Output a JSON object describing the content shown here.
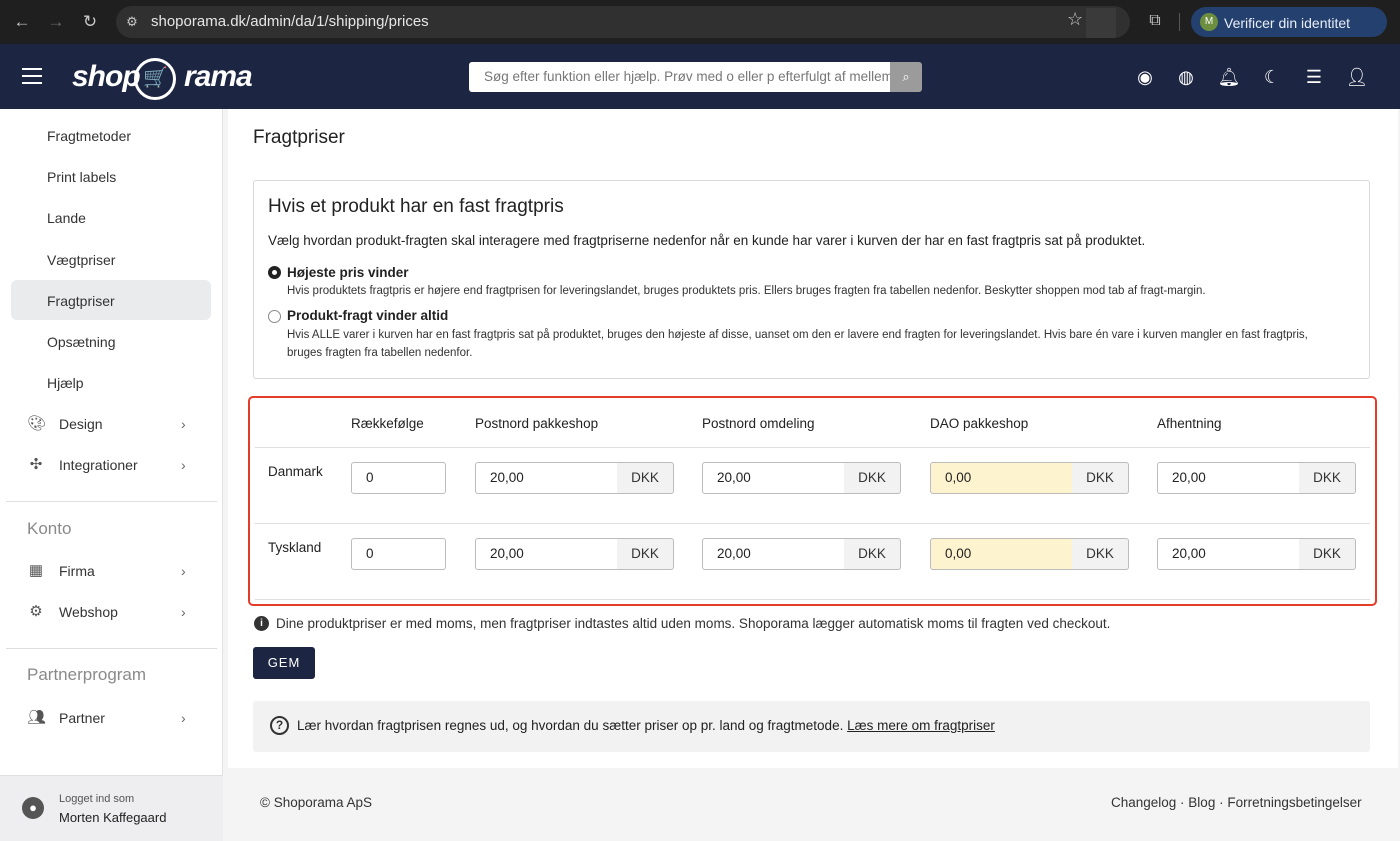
{
  "browser": {
    "url": "shoporama.dk/admin/da/1/shipping/prices",
    "verify_label": "Verificer din identitet",
    "avatar_letter": "M"
  },
  "header": {
    "logo_left": "shop",
    "logo_right": "rama",
    "search_placeholder": "Søg efter funktion eller hjælp. Prøv med o eller p efterfulgt af mellemrum"
  },
  "sidebar": {
    "items": [
      {
        "label": "Fragtmetoder"
      },
      {
        "label": "Print labels"
      },
      {
        "label": "Lande"
      },
      {
        "label": "Vægtpriser"
      },
      {
        "label": "Fragtpriser"
      },
      {
        "label": "Opsætning"
      },
      {
        "label": "Hjælp"
      }
    ],
    "groups": [
      {
        "label": "Design",
        "icon": "palette-icon"
      },
      {
        "label": "Integrationer",
        "icon": "puzzle-icon"
      }
    ],
    "konto_title": "Konto",
    "konto_items": [
      {
        "label": "Firma",
        "icon": "building-icon"
      },
      {
        "label": "Webshop",
        "icon": "gear-icon"
      }
    ],
    "partner_title": "Partnerprogram",
    "partner_items": [
      {
        "label": "Partner",
        "icon": "people-icon"
      }
    ],
    "logged_in_label": "Logget ind som",
    "logged_in_name": "Morten Kaffegaard"
  },
  "main": {
    "page_title": "Fragtpriser",
    "fixed_box": {
      "title": "Hvis et produkt har en fast fragtpris",
      "description": "Vælg hvordan produkt-fragten skal interagere med fragtpriserne nedenfor når en kunde har varer i kurven der har en fast fragtpris sat på produktet.",
      "options": [
        {
          "label": "Højeste pris vinder",
          "help": "Hvis produktets fragtpris er højere end fragtprisen for leveringslandet, bruges produktets pris. Ellers bruges fragten fra tabellen nedenfor. Beskytter shoppen mod tab af fragt-margin.",
          "checked": true
        },
        {
          "label": "Produkt-fragt vinder altid",
          "help": "Hvis ALLE varer i kurven har en fast fragtpris sat på produktet, bruges den højeste af disse, uanset om den er lavere end fragten for leveringslandet. Hvis bare én vare i kurven mangler en fast fragtpris, bruges fragten fra tabellen nedenfor.",
          "checked": false
        }
      ]
    },
    "table": {
      "columns": [
        "Rækkefølge",
        "Postnord pakkeshop",
        "Postnord omdeling",
        "DAO pakkeshop",
        "Afhentning"
      ],
      "currency": "DKK",
      "rows": [
        {
          "country": "Danmark",
          "order": "0",
          "prices": [
            "20,00",
            "20,00",
            "0,00",
            "20,00"
          ]
        },
        {
          "country": "Tyskland",
          "order": "0",
          "prices": [
            "20,00",
            "20,00",
            "0,00",
            "20,00"
          ]
        }
      ]
    },
    "info_text": "Dine produktpriser er med moms, men fragtpriser indtastes altid uden moms. Shoporama lægger automatisk moms til fragten ved checkout.",
    "save_label": "GEM",
    "help_text": "Lær hvordan fragtprisen regnes ud, og hvordan du sætter priser op pr. land og fragtmetode.",
    "help_link": "Læs mere om fragtpriser"
  },
  "footer": {
    "copyright": "© Shoporama ApS",
    "links": "Changelog · Blog · Forretningsbetingelser"
  },
  "colors": {
    "header_bg": "#1c2541",
    "highlight_border": "#e53b2b",
    "warn_field_bg": "#fdf3cf"
  }
}
